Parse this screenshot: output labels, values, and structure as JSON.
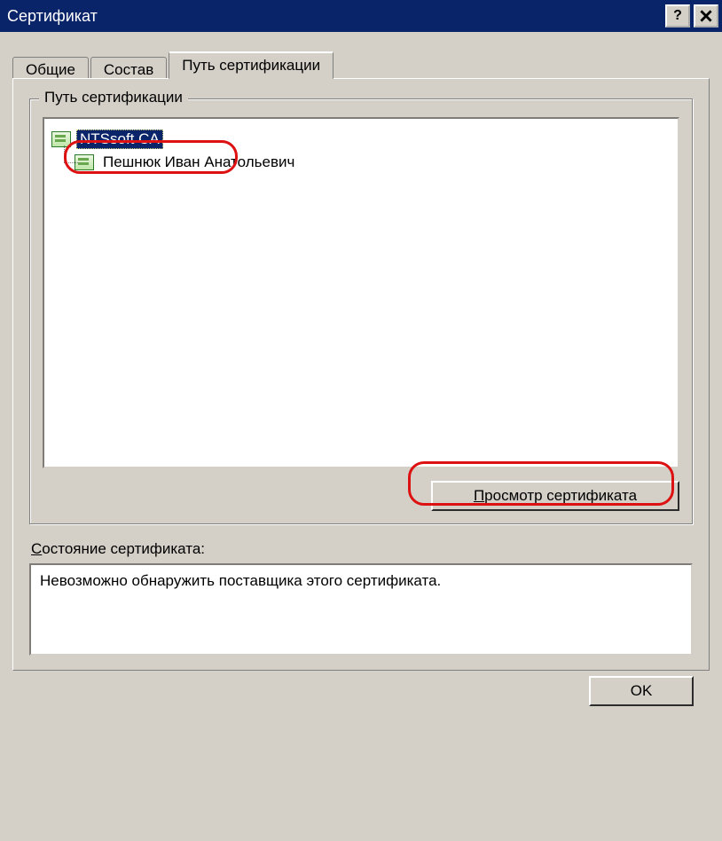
{
  "window": {
    "title": "Сертификат"
  },
  "tabs": {
    "general": "Общие",
    "details": "Состав",
    "path": "Путь сертификации"
  },
  "group": {
    "legend": "Путь сертификации"
  },
  "tree": {
    "root": "NTSsoft CA",
    "child": "Пешнюк Иван Анатольевич"
  },
  "buttons": {
    "view": "Просмотр сертификата",
    "ok": "OK"
  },
  "status": {
    "label": "Состояние сертификата:",
    "value": "Невозможно обнаружить поставщика этого сертификата."
  }
}
